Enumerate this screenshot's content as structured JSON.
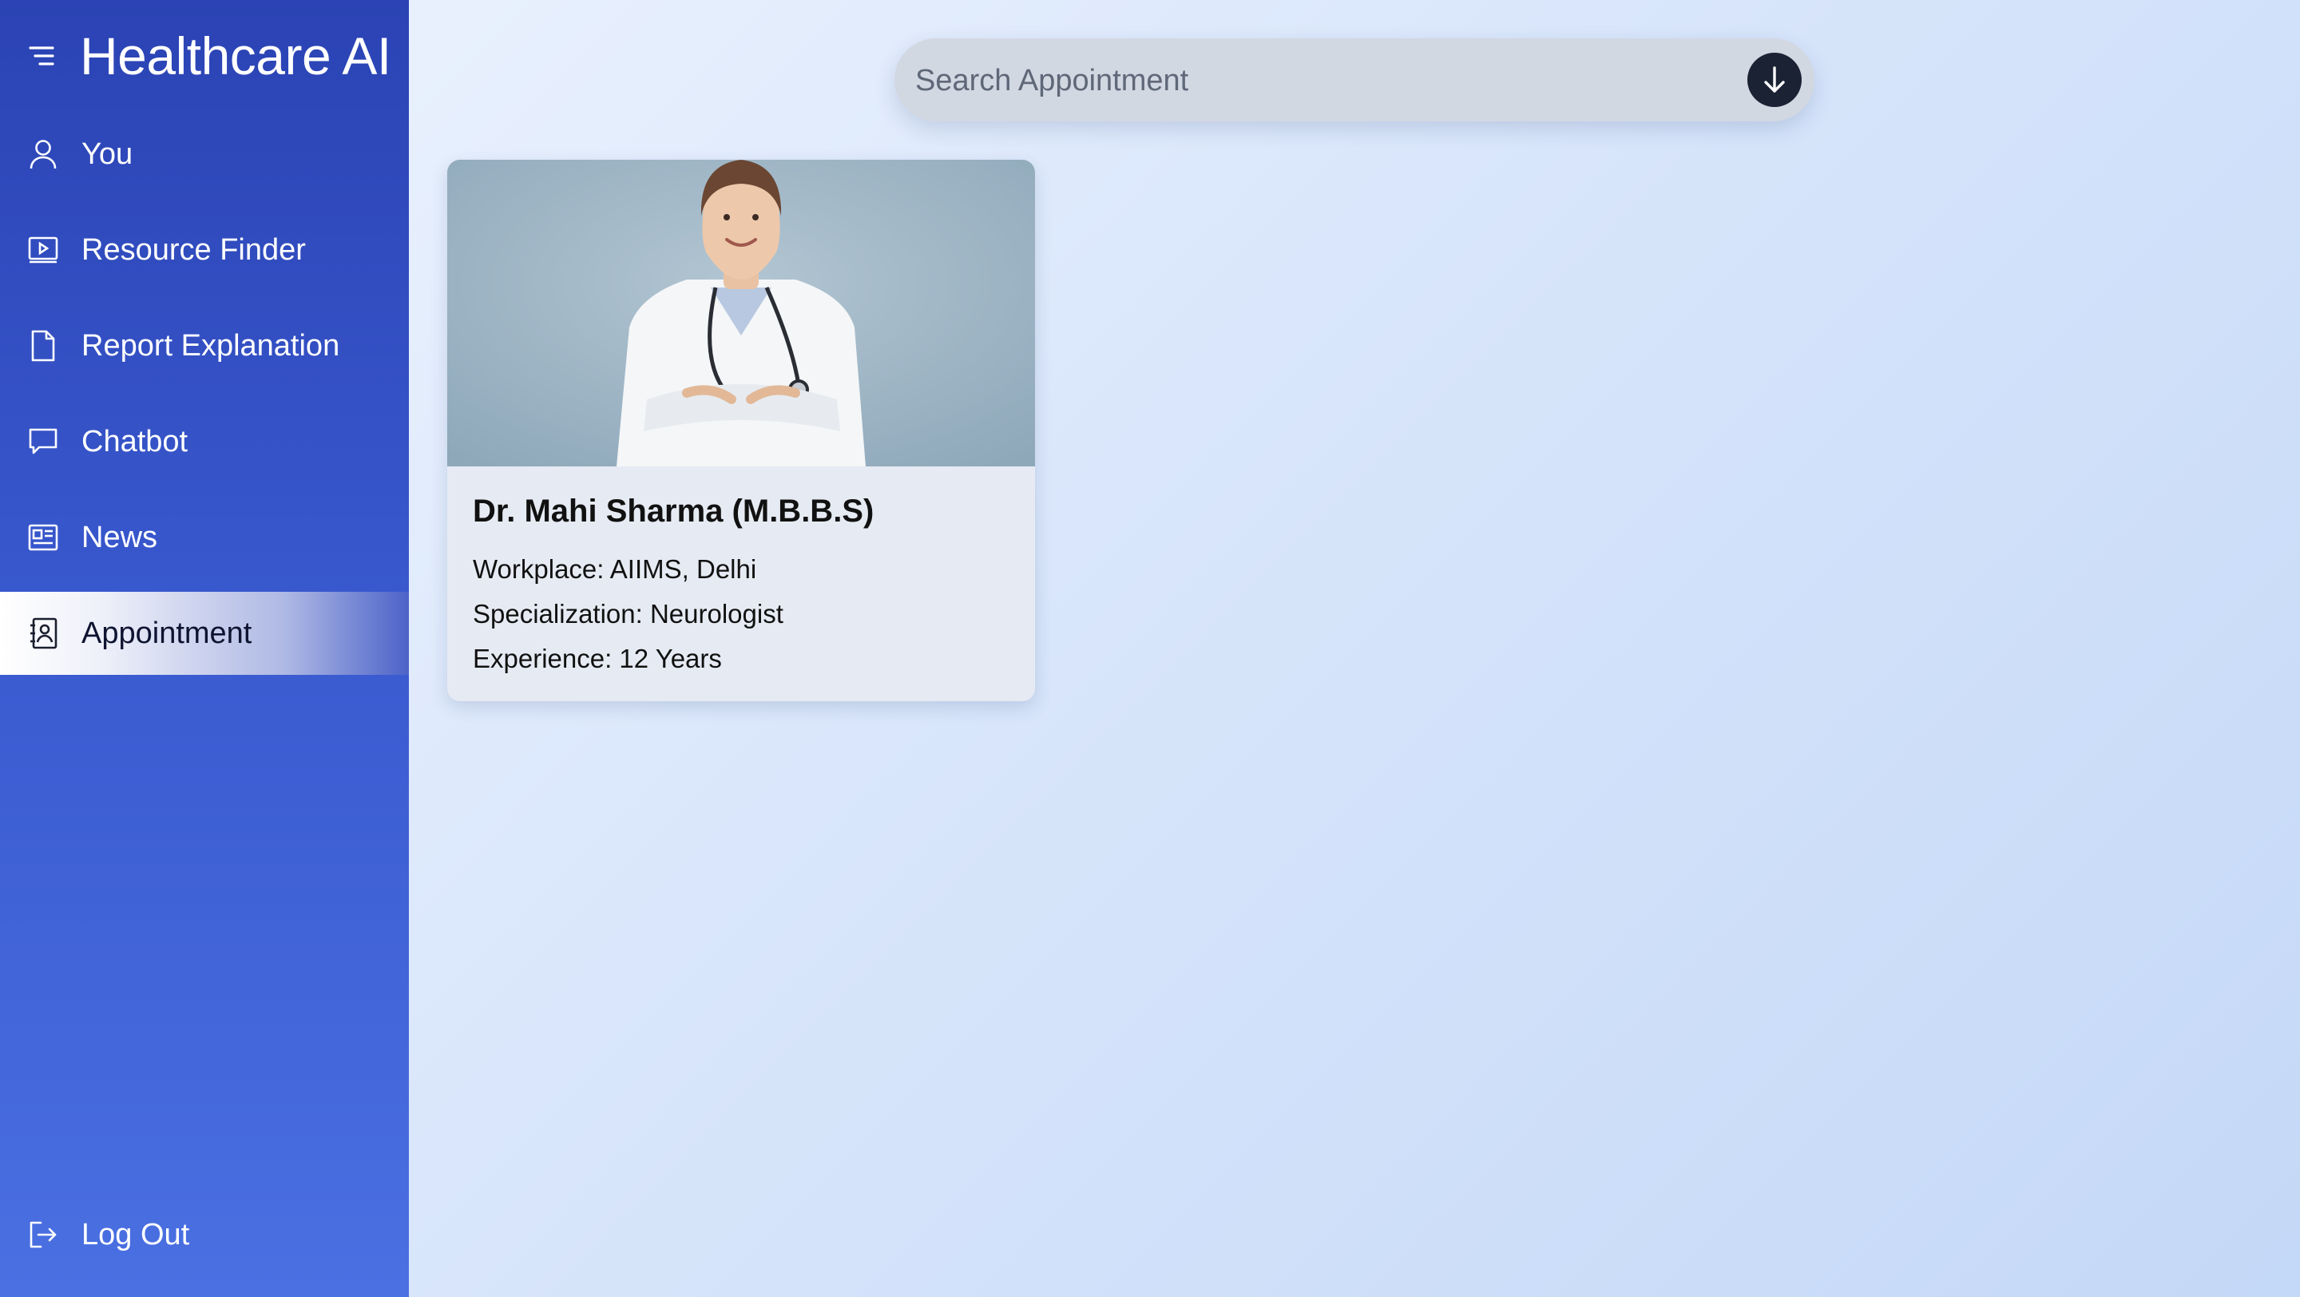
{
  "app": {
    "title": "Healthcare AI"
  },
  "sidebar": {
    "items": [
      {
        "label": "You",
        "icon": "user-icon"
      },
      {
        "label": "Resource Finder",
        "icon": "video-screen-icon"
      },
      {
        "label": "Report Explanation",
        "icon": "document-icon"
      },
      {
        "label": "Chatbot",
        "icon": "chat-bubble-icon"
      },
      {
        "label": "News",
        "icon": "newspaper-icon"
      },
      {
        "label": "Appointment",
        "icon": "contact-book-icon",
        "active": true
      }
    ],
    "logout": {
      "label": "Log Out",
      "icon": "logout-icon"
    }
  },
  "search": {
    "placeholder": "Search Appointment",
    "value": "",
    "button_icon": "arrow-down-icon"
  },
  "doctors": [
    {
      "name": "Dr. Mahi Sharma (M.B.B.S)",
      "workplace": "Workplace: AIIMS, Delhi",
      "specialization": "Specialization: Neurologist",
      "experience": "Experience: 12 Years"
    }
  ],
  "colors": {
    "sidebar_top": "#2b43b4",
    "sidebar_bottom": "#4a70e2",
    "search_button": "#1b2233",
    "card_background": "#e6ebf3"
  }
}
